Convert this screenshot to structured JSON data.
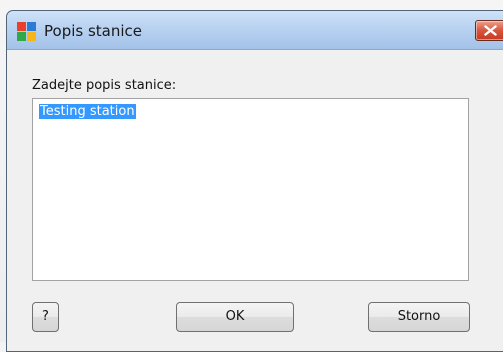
{
  "window": {
    "title": "Popis stanice",
    "app_icon": "avg-logo-icon",
    "close_icon": "close-icon"
  },
  "form": {
    "prompt": "Zadejte popis stanice:",
    "description_value": "Testing station",
    "value_selected": true
  },
  "buttons": {
    "help_label": "?",
    "ok_label": "OK",
    "cancel_label": "Storno"
  },
  "colors": {
    "selection": "#3399ff",
    "close_button": "#d8563c",
    "title_bar": "#b8d2f1"
  }
}
